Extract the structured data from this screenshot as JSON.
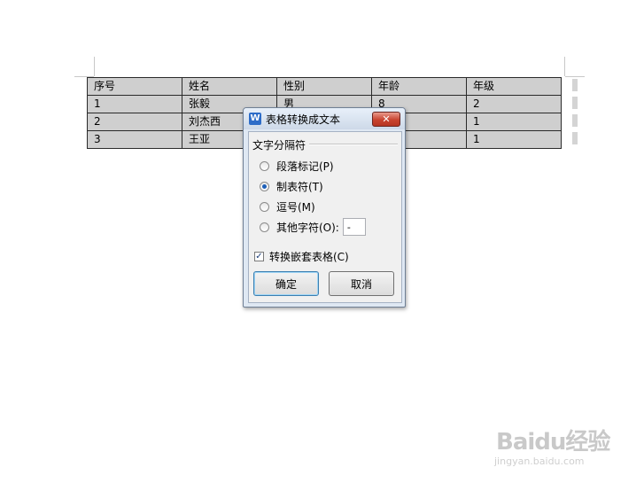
{
  "table": {
    "header": [
      "序号",
      "姓名",
      "性别",
      "年龄",
      "年级"
    ],
    "rows": [
      [
        "1",
        "张毅",
        "男",
        "8",
        "2"
      ],
      [
        "2",
        "刘杰西",
        "",
        "",
        "1"
      ],
      [
        "3",
        "王亚",
        "",
        "",
        "1"
      ]
    ]
  },
  "dialog": {
    "title": "表格转换成文本",
    "app_icon": "W",
    "close_symbol": "✕",
    "group_label": "文字分隔符",
    "options": [
      {
        "label": "段落标记(P)",
        "checked": false
      },
      {
        "label": "制表符(T)",
        "checked": true
      },
      {
        "label": "逗号(M)",
        "checked": false
      },
      {
        "label": "其他字符(O):",
        "checked": false
      }
    ],
    "other_char_value": "-",
    "convert_nested_label": "转换嵌套表格(C)",
    "convert_nested_checked": true,
    "ok_label": "确定",
    "cancel_label": "取消"
  },
  "watermark": {
    "logo": "Baidu经验",
    "url": "jingyan.baidu.com"
  },
  "icons": {
    "app": "wps-writer-icon",
    "close": "close-icon",
    "check": "checkmark-icon"
  },
  "colors": {
    "table_bg": "#cfcfcf",
    "dialog_frame": "#dfe8f3",
    "close_button": "#c8432f",
    "radio_dot": "#1d5fb8"
  }
}
